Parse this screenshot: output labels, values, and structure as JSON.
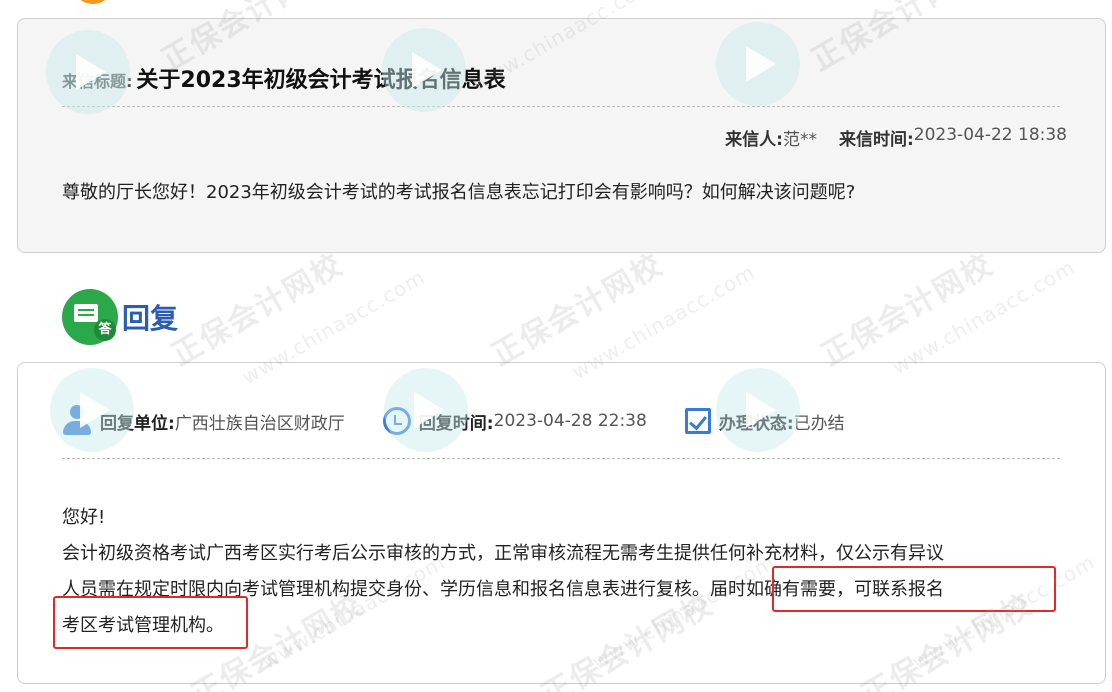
{
  "letter": {
    "title_label": "来信标题:",
    "title": "关于2023年初级会计考试报名信息表",
    "sender_label": "来信人:",
    "sender": "范**",
    "time_label": "来信时间:",
    "time": "2023-04-22 18:38",
    "body": "尊敬的厅长您好！2023年初级会计考试的考试报名信息表忘记打印会有影响吗？如何解决该问题呢?"
  },
  "reply": {
    "heading": "回复",
    "icon_badge": "答",
    "unit_label": "回复单位:",
    "unit": "广西壮族自治区财政厅",
    "time_label": "回复时间:",
    "time": "2023-04-28 22:38",
    "status_label": "办理状态:",
    "status": "已办结",
    "greeting": "您好!",
    "body_line1": "会计初级资格考试广西考区实行考后公示审核的方式，正常审核流程无需考生提供任何补充材料，仅公示有异议",
    "body_line2": "人员需在规定时限内向考试管理机构提交身份、学历信息和报名信息表进行复核。届时如确有需要，可联系报名",
    "body_line3": "考区考试管理机构。"
  },
  "watermark": {
    "text": "正保会计网校",
    "sub": "www.chinaacc.com"
  },
  "colors": {
    "accent_blue": "#3a7bd5",
    "reply_green": "#2aa84a",
    "highlight_red": "#e02a2a"
  }
}
